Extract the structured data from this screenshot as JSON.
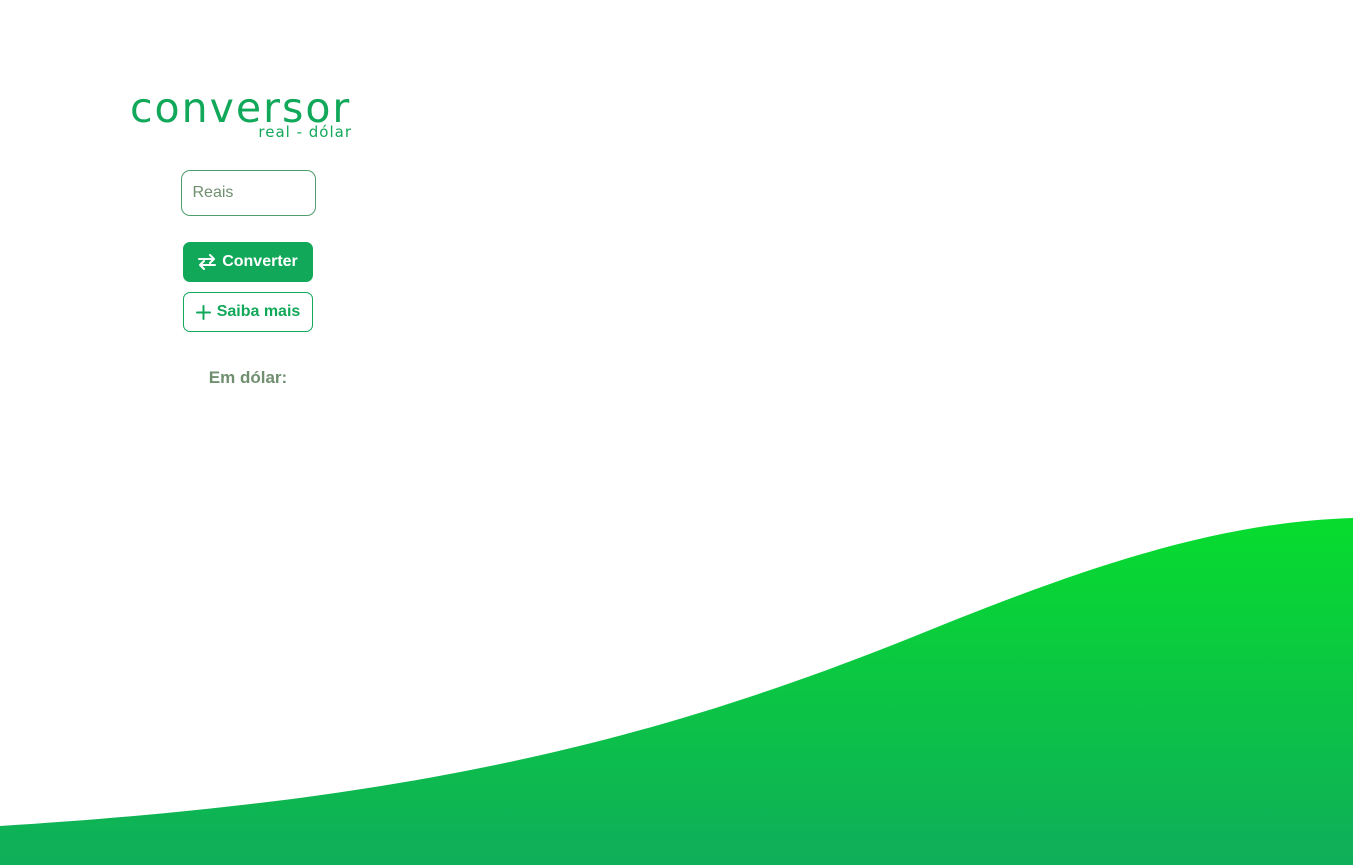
{
  "logo": {
    "title": "conversor",
    "subtitle": "real - dólar"
  },
  "form": {
    "input_placeholder": "Reais",
    "input_value": "",
    "convert_label": "Converter",
    "more_label": "Saiba mais",
    "result_label": "Em dólar:",
    "result_value": ""
  },
  "icons": {
    "convert": "swap-arrows-icon",
    "more": "plus-icon"
  },
  "colors": {
    "accent": "#12a85a",
    "muted_text": "#6f8f6f",
    "wave_top": "#07dc2e",
    "wave_bottom": "#0fae5a"
  }
}
